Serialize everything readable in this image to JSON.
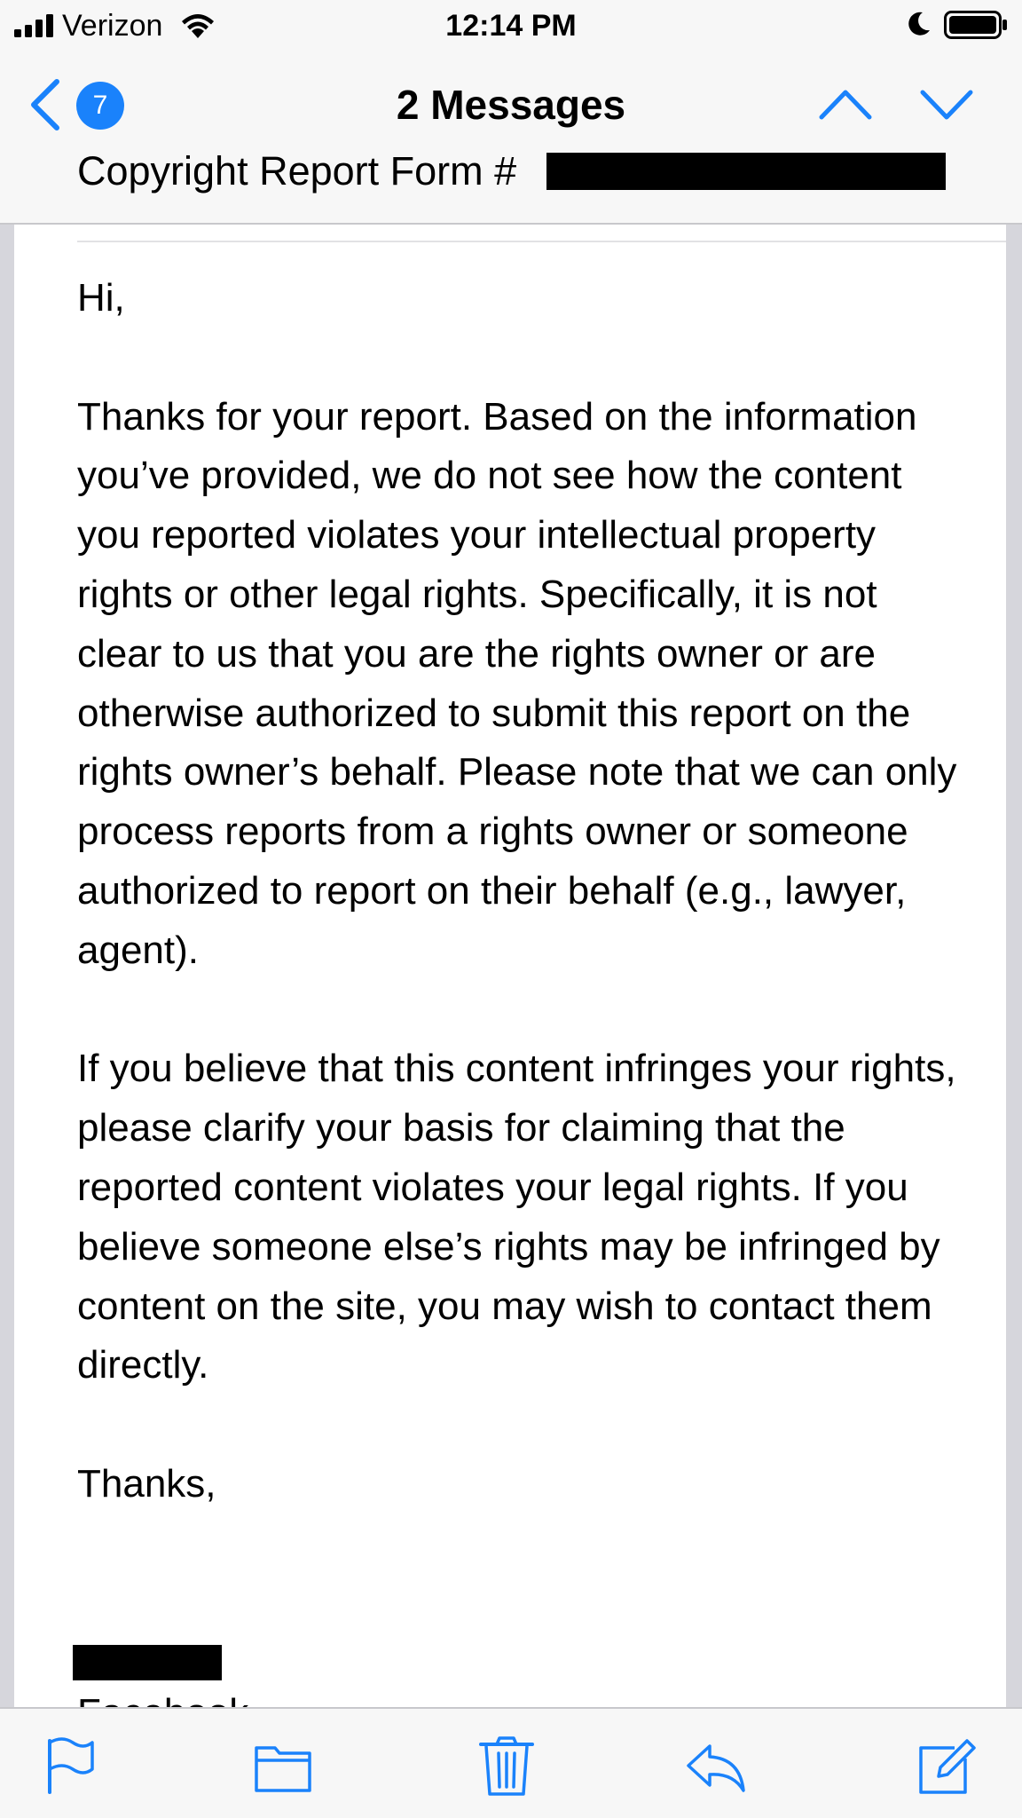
{
  "status_bar": {
    "carrier": "Verizon",
    "time": "12:14 PM"
  },
  "nav": {
    "unread_count": "7",
    "title": "2 Messages",
    "subject": "Copyright Report Form #"
  },
  "message": {
    "paragraphs": [
      "Hi,",
      "Thanks for your report. Based on the information you’ve provided, we do not see how the content you reported violates your intellectual property rights or other legal rights. Specifically, it is not clear to us that you are the rights owner or are otherwise authorized to submit this report on the rights owner’s behalf. Please note that we can only process reports from a rights owner or someone authorized to report on their behalf (e.g., lawyer, agent).",
      "If you believe that this content infringes your rights, please clarify your basis for claiming that the reported content violates your legal rights. If you believe someone else’s rights may be infringed by content on the site, you may wish to contact them directly.",
      "Thanks,"
    ],
    "signature_company": "Facebook"
  },
  "colors": {
    "accent": "#1a82fb",
    "bar_background": "#f7f7f7",
    "page_gutter": "#d6d6dc"
  },
  "icons": [
    "signal-icon",
    "wifi-icon",
    "moon-icon",
    "battery-icon",
    "back-chevron-icon",
    "up-arrow-icon",
    "down-arrow-icon",
    "flag-icon",
    "folder-icon",
    "trash-icon",
    "reply-icon",
    "compose-icon"
  ]
}
